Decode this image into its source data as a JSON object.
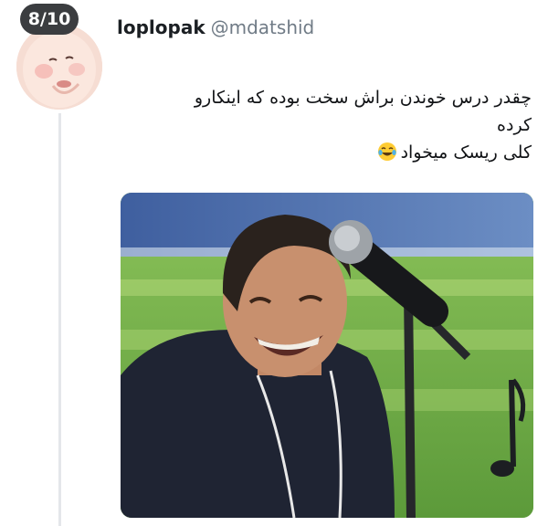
{
  "counter": "8/10",
  "user": {
    "display_name": "loplopak",
    "handle": "@mdatshid"
  },
  "tweet": {
    "line1": "چقدر درس خوندن براش سخت بوده که اینکارو",
    "line2": "کرده",
    "line3": "کلی ریسک  میخواد",
    "emoji": "face-with-tears-of-joy-icon"
  },
  "media": {
    "description_icon": "singer-with-microphone-photo"
  },
  "colors": {
    "counter_bg": "#3b3d40",
    "thread_line": "#e4e6ea",
    "handle": "#707b86"
  }
}
